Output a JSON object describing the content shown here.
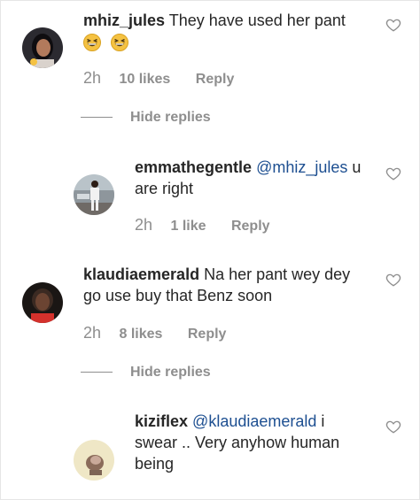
{
  "comments": [
    {
      "username": "mhiz_jules",
      "text": "They have used her pant",
      "emojis": [
        "grinning-squinting-face",
        "grinning-squinting-face"
      ],
      "time": "2h",
      "likes": "10 likes",
      "reply": "Reply",
      "hide_replies": "Hide replies"
    },
    {
      "username": "emmathegentle",
      "mention": "@mhiz_jules",
      "text_line1": "u",
      "text_line2": "are right",
      "time": "2h",
      "likes": "1 like",
      "reply": "Reply"
    },
    {
      "username": "klaudiaemerald",
      "text_line1": "Na her pant wey dey",
      "text_line2": "go use buy that Benz soon",
      "time": "2h",
      "likes": "8 likes",
      "reply": "Reply",
      "hide_replies": "Hide replies"
    },
    {
      "username": "kiziflex",
      "mention": "@klaudiaemerald",
      "text_line1": "i",
      "text_line2": "swear .. Very anyhow human",
      "text_line3": "being"
    }
  ],
  "colors": {
    "text": "#262626",
    "muted": "#8e8e8e",
    "mention": "#1d4f91",
    "emoji": "#f5c242"
  }
}
